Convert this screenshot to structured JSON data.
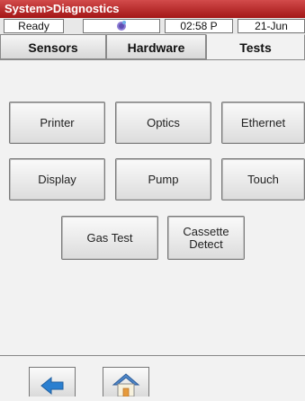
{
  "titlebar": {
    "title": "System>Diagnostics"
  },
  "status": {
    "state": "Ready",
    "time": "02:58 P",
    "date": "21-Jun"
  },
  "tabs": [
    {
      "label": "Sensors"
    },
    {
      "label": "Hardware"
    },
    {
      "label": "Tests",
      "active": true
    }
  ],
  "tests": {
    "printer": "Printer",
    "optics": "Optics",
    "ethernet": "Ethernet",
    "display": "Display",
    "pump": "Pump",
    "touch": "Touch",
    "gas_test": "Gas Test",
    "cassette_detect": "Cassette\nDetect"
  },
  "colors": {
    "titlebar": "#b52222",
    "back_arrow": "#2a7fd0",
    "home_roof": "#4d86c9"
  },
  "icons": {
    "status": "network-icon",
    "back": "back-arrow-icon",
    "home": "home-icon"
  }
}
